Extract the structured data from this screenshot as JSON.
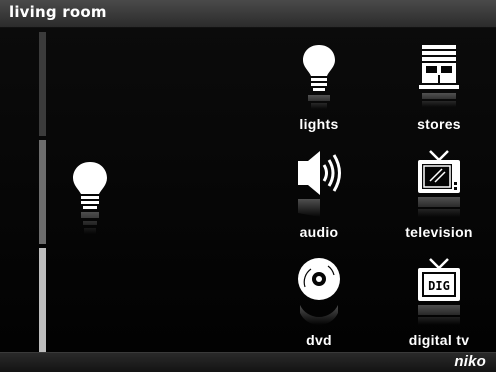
{
  "header": {
    "title": "living room"
  },
  "footer": {
    "brand": "niko"
  },
  "selected_icon": "lightbulb-icon",
  "tiles": [
    {
      "label": "lights",
      "icon": "lightbulb-icon"
    },
    {
      "label": "stores",
      "icon": "blinds-icon"
    },
    {
      "label": "audio",
      "icon": "speaker-icon"
    },
    {
      "label": "television",
      "icon": "tv-icon"
    },
    {
      "label": "dvd",
      "icon": "disc-icon"
    },
    {
      "label": "digital tv",
      "icon": "digital-tv-icon",
      "icon_text": "DIG"
    }
  ]
}
